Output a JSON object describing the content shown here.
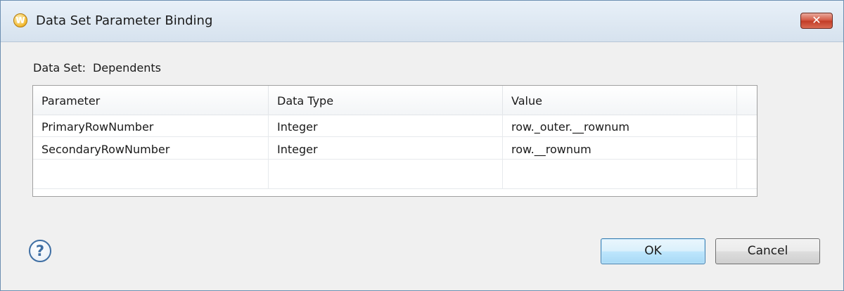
{
  "window": {
    "title": "Data Set Parameter Binding",
    "app_icon_letter": "W",
    "close_glyph": "✕"
  },
  "dataset": {
    "label": "Data Set:",
    "value": "Dependents"
  },
  "table": {
    "columns": [
      "Parameter",
      "Data Type",
      "Value"
    ],
    "rows": [
      [
        "PrimaryRowNumber",
        "Integer",
        "row._outer.__rownum"
      ],
      [
        "SecondaryRowNumber",
        "Integer",
        "row.__rownum"
      ]
    ]
  },
  "footer": {
    "help_glyph": "?",
    "ok_label": "OK",
    "cancel_label": "Cancel"
  },
  "colors": {
    "ok_border": "#3c7fb1",
    "close_red": "#c13b25",
    "help_blue": "#3e6ea3"
  }
}
